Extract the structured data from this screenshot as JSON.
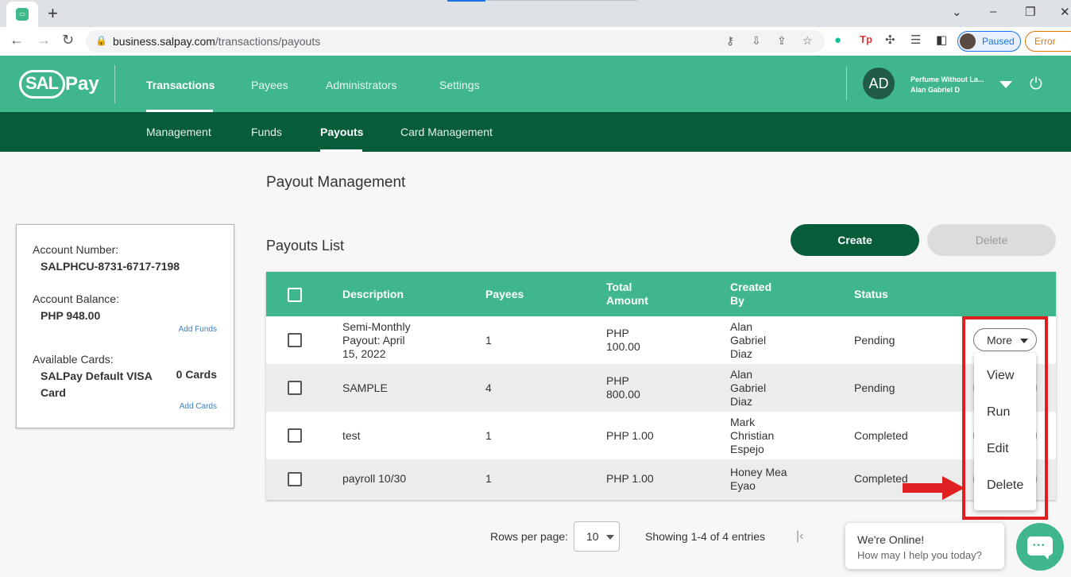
{
  "browser": {
    "url_domain": "business.salpay.com",
    "url_path": "/transactions/payouts",
    "profile_status": "Paused",
    "error_label": "Error"
  },
  "header": {
    "logo_sal": "SAL",
    "logo_pay": "Pay",
    "nav": [
      "Transactions",
      "Payees",
      "Administrators",
      "Settings"
    ],
    "active_nav": "Transactions",
    "user_initials": "AD",
    "user_company": "Perfume Without La...",
    "user_name": "Alan Gabriel D"
  },
  "subnav": {
    "items": [
      "Management",
      "Funds",
      "Payouts",
      "Card Management"
    ],
    "active": "Payouts"
  },
  "page_title": "Payout Management",
  "account": {
    "number_label": "Account Number:",
    "number": "SALPHCU-8731-6717-7198",
    "balance_label": "Account Balance:",
    "balance": "PHP 948.00",
    "add_funds": "Add Funds",
    "cards_label": "Available Cards:",
    "card_name": "SALPay Default VISA Card",
    "card_count": "0 Cards",
    "add_cards": "Add Cards"
  },
  "list": {
    "title": "Payouts List",
    "create_label": "Create",
    "delete_label": "Delete",
    "columns": {
      "description": "Description",
      "payees": "Payees",
      "total_amount": "Total\nAmount",
      "created_by": "Created\nBy",
      "status": "Status"
    },
    "rows": [
      {
        "description": "Semi-Monthly\nPayout: April\n15, 2022",
        "payees": "1",
        "amount": "PHP\n100.00",
        "created_by": "Alan\nGabriel\nDiaz",
        "status": "Pending"
      },
      {
        "description": "SAMPLE",
        "payees": "4",
        "amount": "PHP\n800.00",
        "created_by": "Alan\nGabriel\nDiaz",
        "status": "Pending"
      },
      {
        "description": "test",
        "payees": "1",
        "amount": "PHP 1.00",
        "created_by": "Mark\nChristian\nEspejo",
        "status": "Completed"
      },
      {
        "description": "payroll 10/30",
        "payees": "1",
        "amount": "PHP 1.00",
        "created_by": "Honey Mea\nEyao",
        "status": "Completed"
      }
    ],
    "more_label": "More",
    "menu": [
      "View",
      "Run",
      "Edit",
      "Delete"
    ]
  },
  "pagination": {
    "rows_label": "Rows per page:",
    "rows_value": "10",
    "showing": "Showing 1-4 of 4 entries"
  },
  "chat": {
    "title": "We're Online!",
    "subtitle": "How may I help you today?"
  },
  "colors": {
    "brand_green": "#3fb68b",
    "dark_green": "#075c3a",
    "annotation_red": "#e02020"
  }
}
